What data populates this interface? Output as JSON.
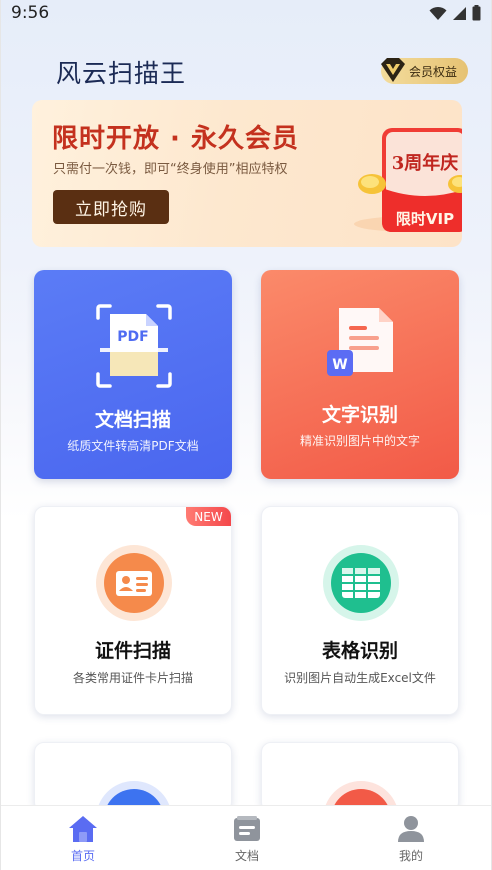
{
  "status_bar": {
    "time": "9:56"
  },
  "header": {
    "app_title": "风云扫描王",
    "vip_badge_label": "会员权益"
  },
  "banner": {
    "title": "限时开放 · 永久会员",
    "subtitle": "只需付一次钱，即可“终身使用”相应特权",
    "button_label": "立即抢购",
    "art_top_label": "3周年庆",
    "art_bottom_label": "限时VIP"
  },
  "features": [
    {
      "title": "文档扫描",
      "desc": "纸质文件转高清PDF文档",
      "icon": "pdf-scan-icon",
      "icon_label": "PDF",
      "color": "#4f6cf2"
    },
    {
      "title": "文字识别",
      "desc": "精准识别图片中的文字",
      "icon": "word-doc-icon",
      "icon_label": "W",
      "color": "#f5664f"
    },
    {
      "title": "证件扫描",
      "desc": "各类常用证件卡片扫描",
      "icon": "id-card-icon",
      "badge": "NEW",
      "color": "#f58a4b"
    },
    {
      "title": "表格识别",
      "desc": "识别图片自动生成Excel文件",
      "icon": "table-icon",
      "color": "#1fbf8f"
    }
  ],
  "bottom_nav": [
    {
      "label": "首页",
      "icon": "home-icon",
      "active": true
    },
    {
      "label": "文档",
      "icon": "document-icon",
      "active": false
    },
    {
      "label": "我的",
      "icon": "profile-icon",
      "active": false
    }
  ],
  "colors": {
    "accent": "#5a6cf2",
    "title": "#1b2a55",
    "banner_title": "#c4311e",
    "banner_button": "#5a2f12"
  }
}
